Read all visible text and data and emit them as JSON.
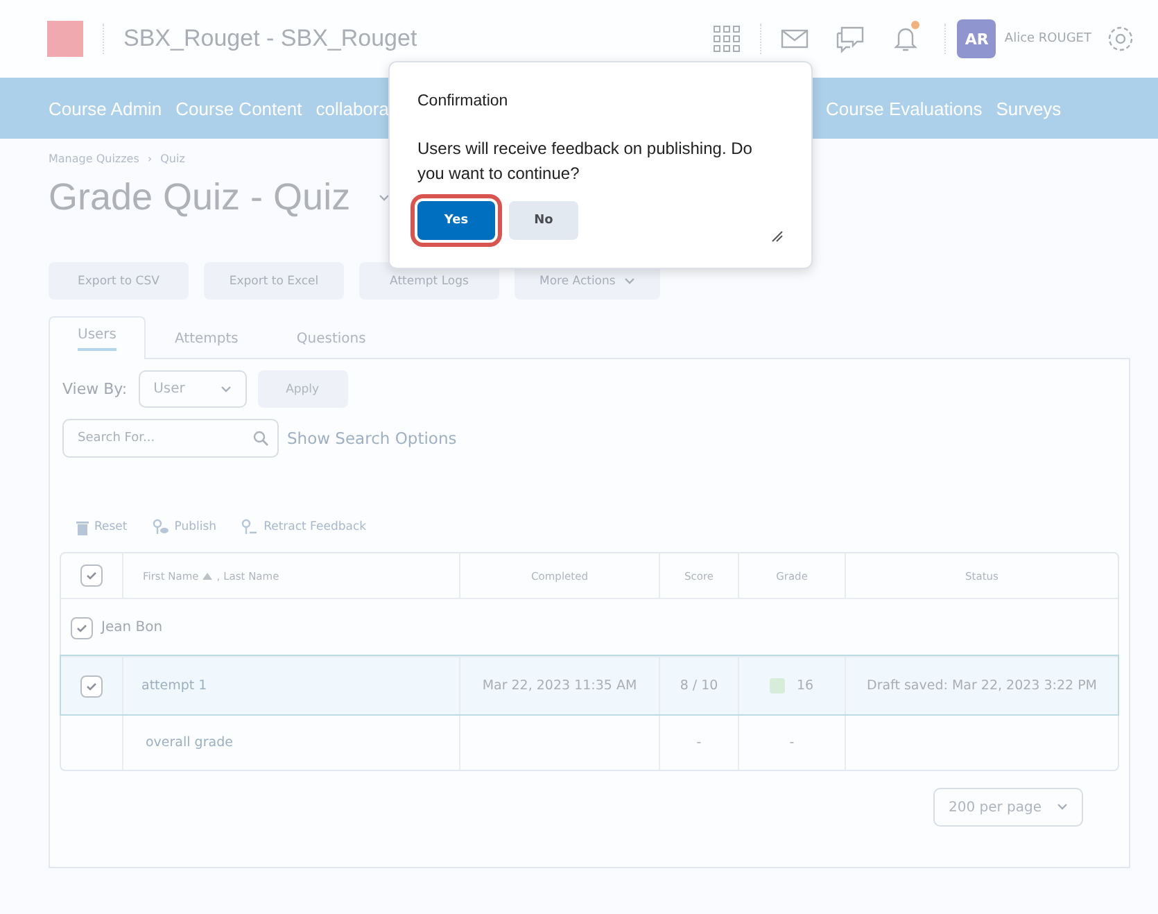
{
  "header": {
    "course_title": "SBX_Rouget - SBX_Rouget",
    "avatar_initials": "AR",
    "user_name": "Alice ROUGET",
    "has_notification": true
  },
  "nav": [
    "Course Admin",
    "Course Content",
    "collabora",
    "Course Evaluations",
    "Surveys"
  ],
  "breadcrumbs": [
    "Manage Quizzes",
    "Quiz"
  ],
  "breadcrumb_separator": "›",
  "page_title": "Grade Quiz - Quiz",
  "actions": [
    {
      "label": "Export to CSV"
    },
    {
      "label": "Export to Excel"
    },
    {
      "label": "Attempt Logs"
    },
    {
      "label": "More Actions",
      "has_menu": true
    }
  ],
  "tabs": [
    {
      "label": "Users",
      "selected": true
    },
    {
      "label": "Attempts",
      "selected": false
    },
    {
      "label": "Questions",
      "selected": false
    }
  ],
  "view_by": {
    "label": "View By:",
    "value": "User",
    "apply": "Apply"
  },
  "search": {
    "placeholder": "Search For...",
    "options_link": "Show Search Options"
  },
  "toolbar": [
    {
      "kind": "trash",
      "label": "Reset"
    },
    {
      "kind": "publish",
      "label": "Publish"
    },
    {
      "kind": "retract",
      "label": "Retract Feedback"
    }
  ],
  "table": {
    "select_all_checked": true,
    "columns": [
      "First Name",
      ", Last Name",
      "Completed",
      "Score",
      "Grade",
      "Status"
    ],
    "user": {
      "name": "Jean Bon",
      "checked": true
    },
    "rows": [
      {
        "label": "attempt 1",
        "checked": true,
        "selected": true,
        "completed": "Mar 22, 2023 11:35 AM",
        "score": "8 / 10",
        "grade": "16",
        "color": "#d7ecd9",
        "status": "Draft saved: Mar 22, 2023 3:22 PM"
      },
      {
        "label": "overall grade",
        "completed": "",
        "score": "-",
        "grade": "-",
        "status": ""
      }
    ]
  },
  "pagination": "200 per page",
  "dialog": {
    "title": "Confirmation",
    "message": "Users will receive feedback on publishing. Do you want to continue?",
    "buttons": [
      {
        "label": "Yes",
        "primary": true,
        "highlighted": true
      },
      {
        "label": "No",
        "primary": false,
        "highlighted": false
      }
    ]
  }
}
